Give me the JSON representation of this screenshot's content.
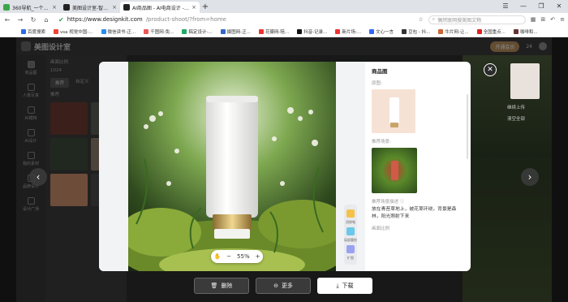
{
  "browser": {
    "tabs": [
      {
        "title": "360导航_一个主页，整个世界",
        "favicon_color": "#3aa64a",
        "active": false
      },
      {
        "title": "美图设计室-智能生成海报一...",
        "favicon_color": "#222222",
        "active": false
      },
      {
        "title": "AI商品图 - AI电商设计 - 美图...",
        "favicon_color": "#222222",
        "active": true
      }
    ],
    "new_tab": "+",
    "url_host": "https://www.designkit.com",
    "url_path": "/product-shoot/?from=home",
    "search_placeholder": "偶然联网搜美图文物",
    "bookmarks": [
      {
        "label": "百度搜索",
        "color": "#2e6be6"
      },
      {
        "label": "vsa 视觉中国-...",
        "color": "#e43"
      },
      {
        "label": "微信读书-正...",
        "color": "#2a8cf0"
      },
      {
        "label": "千图网-免...",
        "color": "#e55"
      },
      {
        "label": "稿定设计-...",
        "color": "#2a6"
      },
      {
        "label": "摄图网-正...",
        "color": "#36c"
      },
      {
        "label": "花瓣网-陪...",
        "color": "#e33"
      },
      {
        "label": "抖音-记录...",
        "color": "#111"
      },
      {
        "label": "新片场-...",
        "color": "#e33"
      },
      {
        "label": "文心一言",
        "color": "#36f"
      },
      {
        "label": "豆包 - 抖...",
        "color": "#333"
      },
      {
        "label": "牛片网-让...",
        "color": "#c63"
      },
      {
        "label": "全国重点...",
        "color": "#d22"
      },
      {
        "label": "咖啡和...",
        "color": "#633"
      }
    ]
  },
  "app": {
    "brand": "美图设计室",
    "vip_label": "开通会员",
    "credits": "24",
    "nav": [
      {
        "label": "商品图",
        "active": true
      },
      {
        "label": "人像写真",
        "active": false
      },
      {
        "label": "AI模特",
        "active": false
      },
      {
        "label": "AI设计",
        "active": false
      },
      {
        "label": "我的素材",
        "active": false
      },
      {
        "label": "品牌设计",
        "active": false
      },
      {
        "label": "设计广场",
        "active": false
      }
    ],
    "panel": {
      "title": "画面比例",
      "size": "1024",
      "tabs": [
        "推荐",
        "自定义"
      ],
      "section": "推荐"
    }
  },
  "modal": {
    "title": "商品图",
    "original_label": "原图:",
    "scene_label": "推荐场景:",
    "desc_label": "推荐场景描述",
    "description": "放在青苔草地上，被花草环绕，背景是森林，阳光照射下来",
    "ratio_label": "画面比例",
    "zoom": {
      "minus": "−",
      "value": "55%",
      "plus": "+"
    },
    "tools": [
      "消除笔",
      "局部重绘",
      "扩图"
    ]
  },
  "actions": {
    "delete": "删除",
    "more": "更多",
    "download": "下载"
  },
  "right_panel": {
    "items": [
      "继续上传",
      "清空全部"
    ]
  }
}
